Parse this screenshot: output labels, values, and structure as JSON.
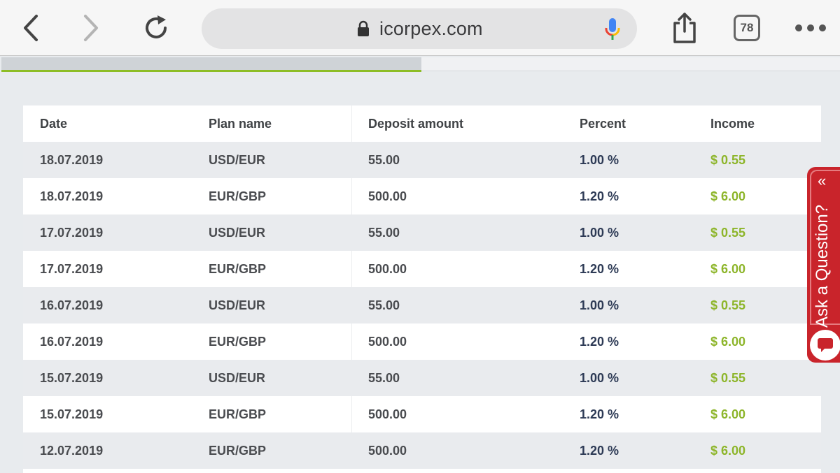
{
  "browser": {
    "url": "icorpex.com",
    "tab_count": "78"
  },
  "table": {
    "headers": [
      "Date",
      "Plan name",
      "Deposit amount",
      "Percent",
      "Income"
    ],
    "rows": [
      [
        "18.07.2019",
        "USD/EUR",
        "55.00",
        "1.00 %",
        "$ 0.55"
      ],
      [
        "18.07.2019",
        "EUR/GBP",
        "500.00",
        "1.20 %",
        "$ 6.00"
      ],
      [
        "17.07.2019",
        "USD/EUR",
        "55.00",
        "1.00 %",
        "$ 0.55"
      ],
      [
        "17.07.2019",
        "EUR/GBP",
        "500.00",
        "1.20 %",
        "$ 6.00"
      ],
      [
        "16.07.2019",
        "USD/EUR",
        "55.00",
        "1.00 %",
        "$ 0.55"
      ],
      [
        "16.07.2019",
        "EUR/GBP",
        "500.00",
        "1.20 %",
        "$ 6.00"
      ],
      [
        "15.07.2019",
        "USD/EUR",
        "55.00",
        "1.00 %",
        "$ 0.55"
      ],
      [
        "15.07.2019",
        "EUR/GBP",
        "500.00",
        "1.20 %",
        "$ 6.00"
      ],
      [
        "12.07.2019",
        "EUR/GBP",
        "500.00",
        "1.20 %",
        "$ 6.00"
      ]
    ]
  },
  "ask_widget": {
    "label": "Ask a Question?",
    "chevron": "«"
  },
  "icons": {
    "back": "back-arrow-icon",
    "forward": "forward-arrow-icon",
    "reload": "reload-icon",
    "lock": "lock-icon",
    "mic": "microphone-icon",
    "share": "share-icon",
    "more": "more-dots-icon",
    "chat": "chat-bubble-icon"
  },
  "colors": {
    "income": "#8db52a",
    "percent": "#2d3a55",
    "active_tab_underline": "#8dbd26",
    "ask_widget": "#c9242b"
  }
}
